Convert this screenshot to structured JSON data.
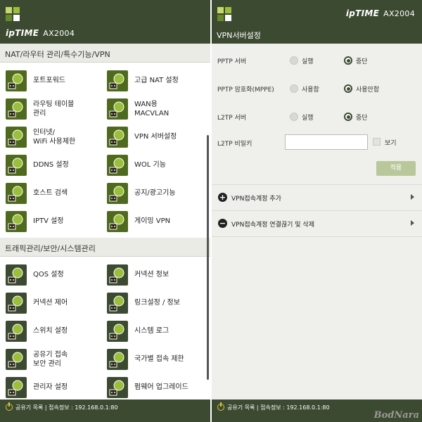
{
  "left": {
    "brand": "ipTIME",
    "model": "AX2004",
    "sections": [
      {
        "title": "NAT/라우터 관리/특수기능/VPN",
        "items": [
          {
            "label": "포트포워드",
            "icon": "port-forward-icon"
          },
          {
            "label": "고급 NAT 설정",
            "icon": "advanced-nat-icon"
          },
          {
            "label": "라우팅 테이블\n관리",
            "icon": "routing-table-icon"
          },
          {
            "label": "WAN용\nMACVLAN",
            "icon": "macvlan-icon"
          },
          {
            "label": "인터넷/\nWiFi 사용제한",
            "icon": "wifi-restrict-icon"
          },
          {
            "label": "VPN 서버설정",
            "icon": "vpn-server-icon"
          },
          {
            "label": "DDNS 설정",
            "icon": "ddns-icon"
          },
          {
            "label": "WOL 기능",
            "icon": "wol-icon"
          },
          {
            "label": "호스트 검색",
            "icon": "host-search-icon"
          },
          {
            "label": "공지/광고기능",
            "icon": "notice-icon"
          },
          {
            "label": "IPTV 설정",
            "icon": "iptv-icon"
          },
          {
            "label": "게이밍 VPN",
            "icon": "gaming-vpn-icon"
          }
        ]
      },
      {
        "title": "트래픽관리/보안/시스템관리",
        "items": [
          {
            "label": "QOS 설정",
            "icon": "qos-icon"
          },
          {
            "label": "커넥션 정보",
            "icon": "connection-info-icon"
          },
          {
            "label": "커넥션 제어",
            "icon": "connection-control-icon"
          },
          {
            "label": "링크설정 / 정보",
            "icon": "link-settings-icon"
          },
          {
            "label": "스위치 설정",
            "icon": "switch-icon"
          },
          {
            "label": "시스템 로그",
            "icon": "system-log-icon"
          },
          {
            "label": "공유기 접속\n보안 관리",
            "icon": "access-security-icon"
          },
          {
            "label": "국가별 접속 제한",
            "icon": "country-restrict-icon"
          },
          {
            "label": "관리자 설정",
            "icon": "admin-icon"
          },
          {
            "label": "펌웨어 업그레이드",
            "icon": "firmware-icon"
          }
        ]
      }
    ],
    "footer": "공유기 목록  |  접속정보 : 192.168.0.1:80"
  },
  "right": {
    "brand": "ipTIME",
    "model": "AX2004",
    "page_title": "VPN서버설정",
    "settings": [
      {
        "label": "PPTP 서버",
        "options": [
          "실행",
          "중단"
        ],
        "selected": 1
      },
      {
        "label": "PPTP 암호화(MPPE)",
        "options": [
          "사용함",
          "사용안함"
        ],
        "selected": 1
      },
      {
        "label": "L2TP 서버",
        "options": [
          "실행",
          "중단"
        ],
        "selected": 1
      }
    ],
    "l2tp_password": {
      "label": "L2TP 비밀키",
      "value": "",
      "show_label": "보기",
      "show_checked": false
    },
    "apply_label": "적용",
    "accordions": [
      {
        "label": "VPN접속계정 추가",
        "icon": "plus-circle-icon"
      },
      {
        "label": "VPN접속계정 연결끊기 및 삭제",
        "icon": "minus-circle-icon"
      }
    ],
    "footer": "공유기 목록  |  접속정보 : 192.168.0.1:80"
  },
  "colors": {
    "header": "#3c4a31",
    "icon_bg": "#4f6a1e",
    "accent_yellow": "#d9c63a",
    "logo_green": "#9bbf3a"
  },
  "watermark": "BodNara"
}
